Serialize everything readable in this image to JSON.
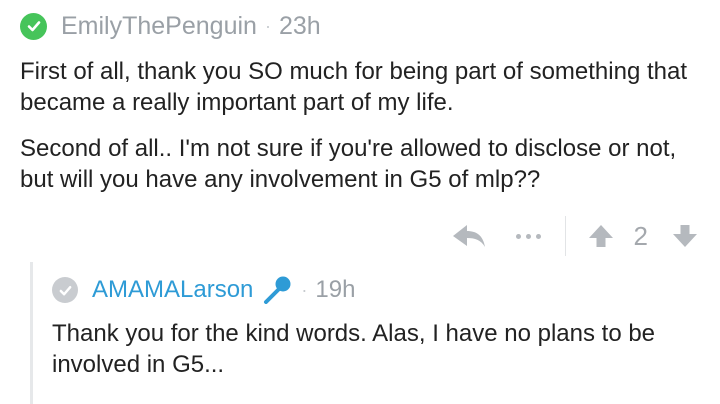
{
  "comment": {
    "username": "EmilyThePenguin",
    "separator": "·",
    "age": "23h",
    "paragraphs": [
      "First of all, thank you SO much for being part of something that became a really important part of my life.",
      "Second of all.. I'm not sure if you're allowed to disclose or not, but will you have any involvement in G5 of mlp??"
    ],
    "badge_icon": "checkmark-circle-icon",
    "badge_color": "#46c45a",
    "vote_count": "2"
  },
  "reply": {
    "username": "AMAMALarson",
    "separator": "·",
    "age": "19h",
    "text": "Thank you for the kind words. Alas, I have no plans to be involved in G5...",
    "badge_icon": "checkmark-circle-icon",
    "badge_color": "#c9ccd0",
    "flair_icon": "microphone-icon",
    "link_color": "#2e9bd6"
  },
  "actions": {
    "reply_icon": "reply-arrow-icon",
    "more_icon": "more-dots-icon",
    "upvote_icon": "upvote-arrow-icon",
    "downvote_icon": "downvote-arrow-icon"
  }
}
